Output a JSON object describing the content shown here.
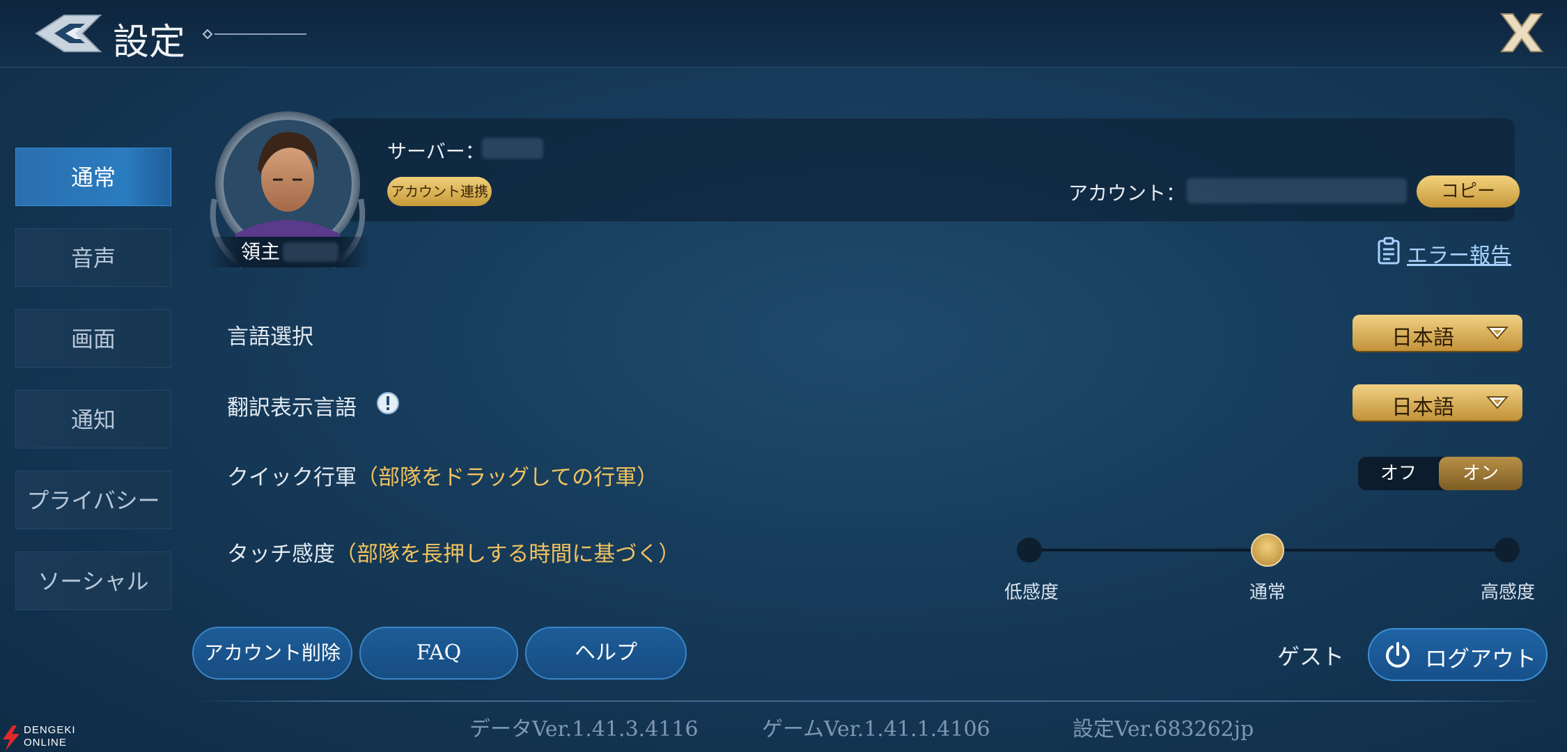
{
  "header": {
    "title": "設定",
    "close_label": "X"
  },
  "sidebar": {
    "items": [
      {
        "label": "通常",
        "active": true
      },
      {
        "label": "音声",
        "active": false
      },
      {
        "label": "画面",
        "active": false
      },
      {
        "label": "通知",
        "active": false
      },
      {
        "label": "プライバシー",
        "active": false
      },
      {
        "label": "ソーシャル",
        "active": false
      }
    ]
  },
  "profile": {
    "lord_label": "領主",
    "server_label": "サーバー：",
    "link_button": "アカウント連携",
    "account_label": "アカウント：",
    "copy_button": "コピー",
    "error_report": "エラー報告"
  },
  "settings": {
    "language": {
      "label": "言語選択",
      "value": "日本語"
    },
    "translation": {
      "label": "翻訳表示言語",
      "value": "日本語"
    },
    "quick_march": {
      "label": "クイック行軍",
      "note": "（部隊をドラッグしての行軍）",
      "off": "オフ",
      "on": "オン",
      "state": "on"
    },
    "touch": {
      "label": "タッチ感度",
      "note": "（部隊を長押しする時間に基づく）",
      "levels": [
        "低感度",
        "通常",
        "高感度"
      ],
      "selected": "通常"
    }
  },
  "footer": {
    "delete_account": "アカウント削除",
    "faq": "FAQ",
    "help": "ヘルプ",
    "guest": "ゲスト",
    "logout": "ログアウト",
    "versions": {
      "data": "データVer.1.41.3.4116",
      "game": "ゲームVer.1.41.1.4106",
      "settings": "設定Ver.683262jp"
    }
  },
  "watermark": {
    "line1": "DENGEKI",
    "line2": "ONLINE"
  },
  "colors": {
    "accent_gold": "#d4a64a",
    "accent_blue": "#2a7cc0",
    "background": "#163a59"
  }
}
